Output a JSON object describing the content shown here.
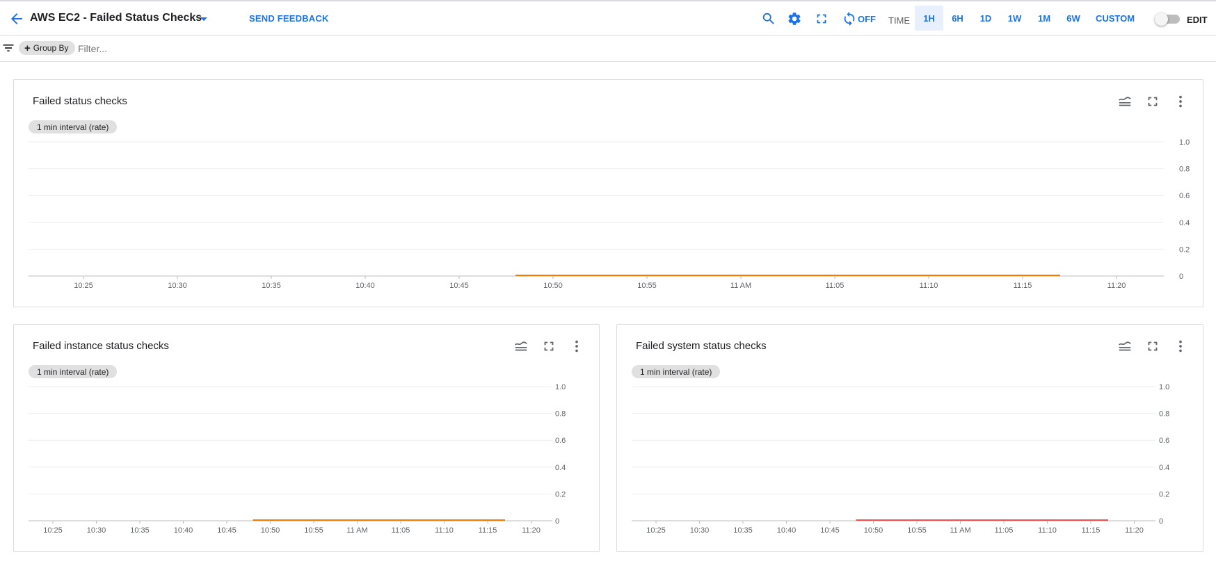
{
  "header": {
    "title": "AWS EC2 - Failed Status Checks",
    "send_feedback": "SEND FEEDBACK",
    "auto_refresh": "OFF",
    "time_label": "TIME",
    "ranges": [
      "1H",
      "6H",
      "1D",
      "1W",
      "1M",
      "6W",
      "CUSTOM"
    ],
    "active_range": "1H",
    "edit_label": "EDIT",
    "edit_enabled": false
  },
  "filterbar": {
    "group_by_label": "Group By",
    "filter_placeholder": "Filter..."
  },
  "icons": {
    "back": "arrow-left-icon",
    "dropdown": "caret-down-icon",
    "search": "search-icon",
    "settings": "gear-icon",
    "fullscreen": "fullscreen-icon",
    "refresh": "refresh-icon",
    "filter": "filter-icon",
    "legend": "legend-icon",
    "expand": "expand-icon",
    "more": "more-vert-icon"
  },
  "colors": {
    "accent": "#1a73e8",
    "series_orange": "#f57c00",
    "series_red": "#ef5350"
  },
  "panels": [
    {
      "title": "Failed status checks",
      "interval_chip": "1 min interval (rate)",
      "chart_data": {
        "type": "line",
        "x_ticks": [
          "10:25",
          "10:30",
          "10:35",
          "10:40",
          "10:45",
          "10:50",
          "10:55",
          "11 AM",
          "11:05",
          "11:10",
          "11:15",
          "11:20"
        ],
        "y_ticks": [
          "0",
          "0.2",
          "0.4",
          "0.6",
          "0.8",
          "1.0"
        ],
        "ylim": [
          0,
          1
        ],
        "series": [
          {
            "color": "#f57c00",
            "x": [
              "10:48",
              "11:17"
            ],
            "y": [
              0,
              0
            ]
          }
        ]
      }
    },
    {
      "title": "Failed instance status checks",
      "interval_chip": "1 min interval (rate)",
      "chart_data": {
        "type": "line",
        "x_ticks": [
          "10:25",
          "10:30",
          "10:35",
          "10:40",
          "10:45",
          "10:50",
          "10:55",
          "11 AM",
          "11:05",
          "11:10",
          "11:15",
          "11:20"
        ],
        "y_ticks": [
          "0",
          "0.2",
          "0.4",
          "0.6",
          "0.8",
          "1.0"
        ],
        "ylim": [
          0,
          1
        ],
        "series": [
          {
            "color": "#f57c00",
            "x": [
              "10:48",
              "11:17"
            ],
            "y": [
              0,
              0
            ]
          }
        ]
      }
    },
    {
      "title": "Failed system status checks",
      "interval_chip": "1 min interval (rate)",
      "chart_data": {
        "type": "line",
        "x_ticks": [
          "10:25",
          "10:30",
          "10:35",
          "10:40",
          "10:45",
          "10:50",
          "10:55",
          "11 AM",
          "11:05",
          "11:10",
          "11:15",
          "11:20"
        ],
        "y_ticks": [
          "0",
          "0.2",
          "0.4",
          "0.6",
          "0.8",
          "1.0"
        ],
        "ylim": [
          0,
          1
        ],
        "series": [
          {
            "color": "#ef5350",
            "x": [
              "10:48",
              "11:17"
            ],
            "y": [
              0,
              0
            ]
          }
        ]
      }
    }
  ]
}
